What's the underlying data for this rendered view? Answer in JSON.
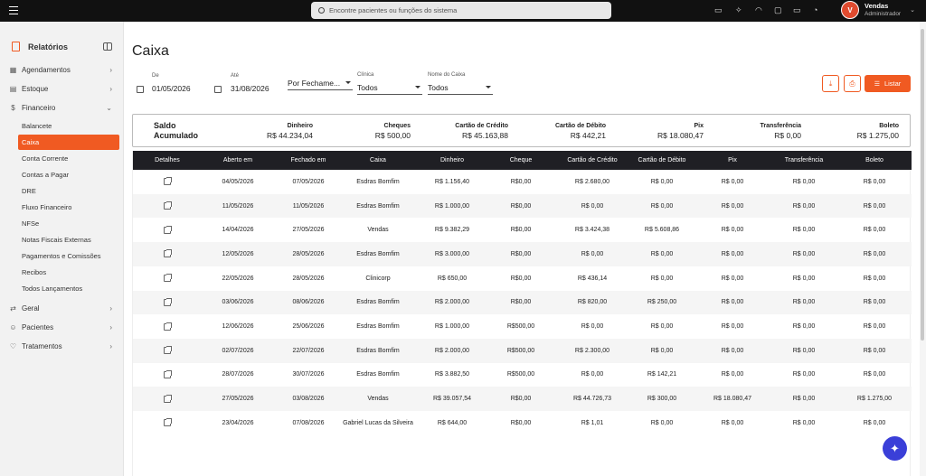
{
  "topbar": {
    "search_placeholder": "Encontre pacientes ou funções do sistema",
    "icons": [
      "video-icon",
      "sparkle-icon",
      "headset-icon",
      "chat-icon",
      "message-icon",
      "bell-icon"
    ],
    "user": {
      "initial": "V",
      "name": "Vendas",
      "role": "Administrador"
    }
  },
  "sidebar": {
    "title": "Relatórios",
    "items": [
      {
        "label": "Agendamentos",
        "icon": "calendar-icon"
      },
      {
        "label": "Estoque",
        "icon": "box-icon"
      },
      {
        "label": "Financeiro",
        "icon": "dollar-icon"
      },
      {
        "label": "Geral",
        "icon": "shuffle-icon"
      },
      {
        "label": "Pacientes",
        "icon": "users-icon"
      },
      {
        "label": "Tratamentos",
        "icon": "tooth-icon"
      }
    ],
    "financeiro_sub": [
      "Balancete",
      "Caixa",
      "Conta Corrente",
      "Contas a Pagar",
      "DRE",
      "Fluxo Financeiro",
      "NFSe",
      "Notas Fiscais Externas",
      "Pagamentos e Comissões",
      "Recibos",
      "Todos Lançamentos"
    ],
    "active_sub": "Caixa"
  },
  "page": {
    "title": "Caixa"
  },
  "filters": {
    "de_label": "De",
    "de_value": "01/05/2026",
    "ate_label": "Até",
    "ate_value": "31/08/2026",
    "tipo_value": "Por Fechame...",
    "clinica_label": "Clínica",
    "clinica_value": "Todos",
    "caixa_label": "Nome do Caixa",
    "caixa_value": "Todos"
  },
  "actions": {
    "listar_label": "Listar"
  },
  "summary": {
    "label_line1": "Saldo",
    "label_line2": "Acumulado",
    "cols": [
      {
        "label": "Dinheiro",
        "value": "R$ 44.234,04"
      },
      {
        "label": "Cheques",
        "value": "R$ 500,00"
      },
      {
        "label": "Cartão de Crédito",
        "value": "R$ 45.163,88"
      },
      {
        "label": "Cartão de Débito",
        "value": "R$ 442,21"
      },
      {
        "label": "Pix",
        "value": "R$ 18.080,47"
      },
      {
        "label": "Transferência",
        "value": "R$ 0,00"
      },
      {
        "label": "Boleto",
        "value": "R$ 1.275,00"
      }
    ]
  },
  "table": {
    "headers": [
      "Detalhes",
      "Aberto em",
      "Fechado em",
      "Caixa",
      "Dinheiro",
      "Cheque",
      "Cartão de Crédito",
      "Cartão de Débito",
      "Pix",
      "Transferência",
      "Boleto"
    ],
    "rows": [
      [
        "04/05/2026",
        "07/05/2026",
        "Esdras Bomfim",
        "R$ 1.156,40",
        "R$0,00",
        "R$ 2.680,00",
        "R$ 0,00",
        "R$ 0,00",
        "R$ 0,00",
        "R$ 0,00"
      ],
      [
        "11/05/2026",
        "11/05/2026",
        "Esdras Bomfim",
        "R$ 1.000,00",
        "R$0,00",
        "R$ 0,00",
        "R$ 0,00",
        "R$ 0,00",
        "R$ 0,00",
        "R$ 0,00"
      ],
      [
        "14/04/2026",
        "27/05/2026",
        "Vendas",
        "R$ 9.382,29",
        "R$0,00",
        "R$ 3.424,38",
        "R$ 5.608,86",
        "R$ 0,00",
        "R$ 0,00",
        "R$ 0,00"
      ],
      [
        "12/05/2026",
        "28/05/2026",
        "Esdras Bomfim",
        "R$ 3.000,00",
        "R$0,00",
        "R$ 0,00",
        "R$ 0,00",
        "R$ 0,00",
        "R$ 0,00",
        "R$ 0,00"
      ],
      [
        "22/05/2026",
        "28/05/2026",
        "Clinicorp",
        "R$ 650,00",
        "R$0,00",
        "R$ 436,14",
        "R$ 0,00",
        "R$ 0,00",
        "R$ 0,00",
        "R$ 0,00"
      ],
      [
        "03/06/2026",
        "08/06/2026",
        "Esdras Bomfim",
        "R$ 2.000,00",
        "R$0,00",
        "R$ 820,00",
        "R$ 250,00",
        "R$ 0,00",
        "R$ 0,00",
        "R$ 0,00"
      ],
      [
        "12/06/2026",
        "25/06/2026",
        "Esdras Bomfim",
        "R$ 1.000,00",
        "R$500,00",
        "R$ 0,00",
        "R$ 0,00",
        "R$ 0,00",
        "R$ 0,00",
        "R$ 0,00"
      ],
      [
        "02/07/2026",
        "22/07/2026",
        "Esdras Bomfim",
        "R$ 2.000,00",
        "R$500,00",
        "R$ 2.300,00",
        "R$ 0,00",
        "R$ 0,00",
        "R$ 0,00",
        "R$ 0,00"
      ],
      [
        "28/07/2026",
        "30/07/2026",
        "Esdras Bomfim",
        "R$ 3.882,50",
        "R$500,00",
        "R$ 0,00",
        "R$ 142,21",
        "R$ 0,00",
        "R$ 0,00",
        "R$ 0,00"
      ],
      [
        "27/05/2026",
        "03/08/2026",
        "Vendas",
        "R$ 39.057,54",
        "R$0,00",
        "R$ 44.726,73",
        "R$ 300,00",
        "R$ 18.080,47",
        "R$ 0,00",
        "R$ 1.275,00"
      ],
      [
        "23/04/2026",
        "07/08/2026",
        "Gabriel Lucas da Silveira",
        "R$ 644,00",
        "R$0,00",
        "R$ 1,01",
        "R$ 0,00",
        "R$ 0,00",
        "R$ 0,00",
        "R$ 0,00"
      ]
    ]
  },
  "colors": {
    "accent": "#f05a22",
    "header_dark": "#1f1f24",
    "fab": "#3a3fd8"
  }
}
